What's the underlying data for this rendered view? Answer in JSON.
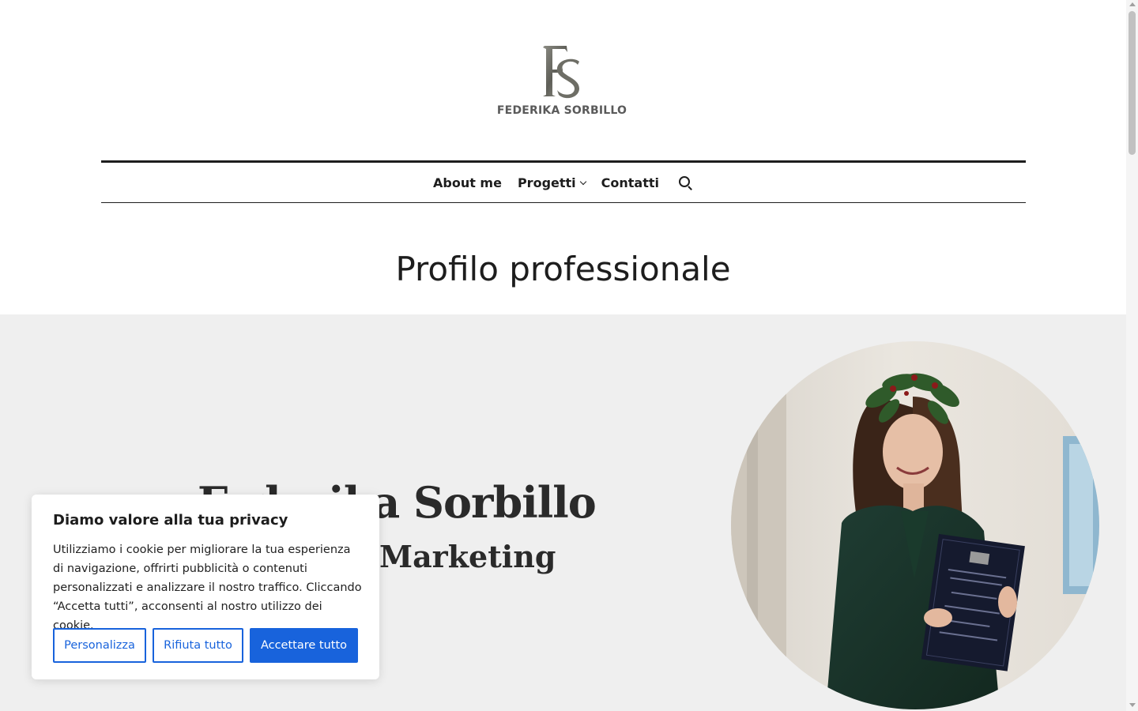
{
  "header": {
    "logo_monogram": "FS",
    "logo_text": "FEDERIKA SORBILLO",
    "nav": {
      "about": "About me",
      "projects": "Progetti",
      "contacts": "Contatti"
    },
    "icons": {
      "search": "search-icon",
      "chevron": "chevron-down-icon"
    }
  },
  "page": {
    "title": "Profilo professionale"
  },
  "hero": {
    "name": "Federika Sorbillo",
    "role": "Marketing"
  },
  "cookie_banner": {
    "title": "Diamo valore alla tua privacy",
    "text": "Utilizziamo i cookie per migliorare la tua esperienza di navigazione, offrirti pubblicità o contenuti personalizzati e analizzare il nostro traffico. Cliccando “Accetta tutti”, acconsenti al nostro utilizzo dei cookie.",
    "buttons": {
      "customize": "Personalizza",
      "reject": "Rifiuta tutto",
      "accept": "Accettare tutto"
    }
  },
  "colors": {
    "accent": "#1863dc",
    "hero_bg": "#efefef",
    "text": "#1d1d1d"
  }
}
